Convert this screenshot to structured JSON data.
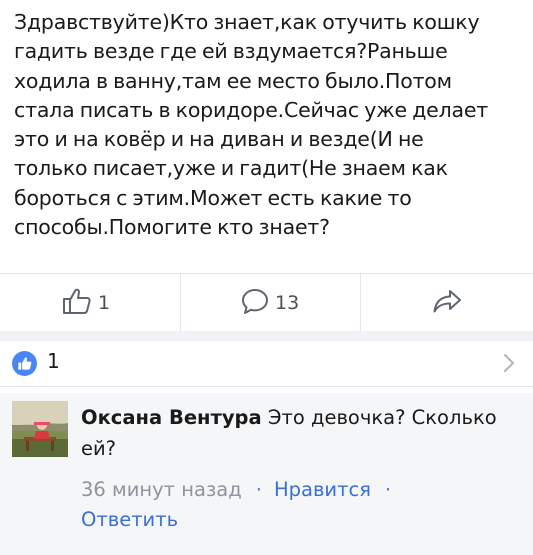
{
  "post": {
    "text_lines": [
      "Здравствуйте)Кто знает,как отучить кошку",
      "гадить везде где ей вздумается?Раньше",
      "ходила в ванну,там ее место было.Потом",
      "стала писать в коридоре.Сейчас уже делает",
      "это и на ковёр и на диван и везде(И не",
      "только писает,уже и гадит(Не знаем как",
      "бороться с этим.Может есть какие то",
      "способы.Помогите кто знает?"
    ]
  },
  "actions": {
    "like_icon": "thumbs-up-icon",
    "like_count": "1",
    "comment_icon": "comment-bubble-icon",
    "comment_count": "13",
    "share_icon": "share-arrow-icon"
  },
  "reactions": {
    "icon": "like-badge-icon",
    "count": "1",
    "chevron_icon": "chevron-right-icon"
  },
  "comment": {
    "avatar": "avatar",
    "author": "Оксана Вентура",
    "text": "Это девочка? Сколько ей?",
    "time": "36 минут назад",
    "dot1": "·",
    "like_label": "Нравится",
    "dot2": "·",
    "reply_label": "Ответить"
  },
  "colors": {
    "link": "#3b6fd6",
    "like_badge": "#4a86f3",
    "muted_text": "#8d949e",
    "comment_background": "#f5f6f7"
  }
}
